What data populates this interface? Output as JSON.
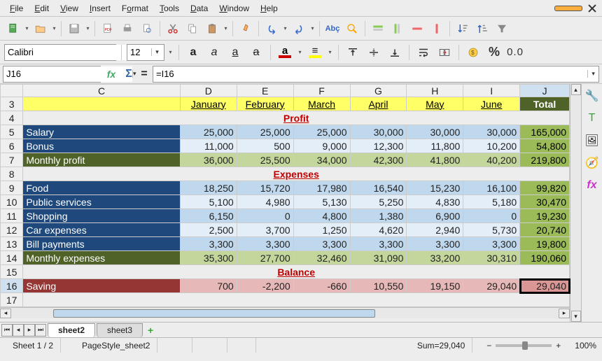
{
  "menu": {
    "file": "File",
    "edit": "Edit",
    "view": "View",
    "insert": "Insert",
    "format": "Format",
    "tools": "Tools",
    "data": "Data",
    "window": "Window",
    "help": "Help"
  },
  "font": {
    "name": "Calibri",
    "size": "12"
  },
  "formula": {
    "cellref": "J16",
    "content": "=I16"
  },
  "columns": [
    "C",
    "D",
    "E",
    "F",
    "G",
    "H",
    "I",
    "J"
  ],
  "rownums": [
    "3",
    "4",
    "5",
    "6",
    "7",
    "8",
    "9",
    "10",
    "11",
    "12",
    "13",
    "14",
    "15",
    "16",
    "17"
  ],
  "months": [
    "January",
    "February",
    "March",
    "April",
    "May",
    "June"
  ],
  "totalLabel": "Total",
  "sections": {
    "profit": "Profit",
    "expenses": "Expenses",
    "balance": "Balance"
  },
  "rows": {
    "salary": {
      "label": "Salary",
      "vals": [
        "25,000",
        "25,000",
        "25,000",
        "30,000",
        "30,000",
        "30,000"
      ],
      "tot": "165,000"
    },
    "bonus": {
      "label": "Bonus",
      "vals": [
        "11,000",
        "500",
        "9,000",
        "12,300",
        "11,800",
        "10,200"
      ],
      "tot": "54,800"
    },
    "mprofit": {
      "label": "Monthly profit",
      "vals": [
        "36,000",
        "25,500",
        "34,000",
        "42,300",
        "41,800",
        "40,200"
      ],
      "tot": "219,800"
    },
    "food": {
      "label": "Food",
      "vals": [
        "18,250",
        "15,720",
        "17,980",
        "16,540",
        "15,230",
        "16,100"
      ],
      "tot": "99,820"
    },
    "public": {
      "label": "Public services",
      "vals": [
        "5,100",
        "4,980",
        "5,130",
        "5,250",
        "4,830",
        "5,180"
      ],
      "tot": "30,470"
    },
    "shopping": {
      "label": "Shopping",
      "vals": [
        "6,150",
        "0",
        "4,800",
        "1,380",
        "6,900",
        "0"
      ],
      "tot": "19,230"
    },
    "car": {
      "label": "Car expenses",
      "vals": [
        "2,500",
        "3,700",
        "1,250",
        "4,620",
        "2,940",
        "5,730"
      ],
      "tot": "20,740"
    },
    "bill": {
      "label": "Bill payments",
      "vals": [
        "3,300",
        "3,300",
        "3,300",
        "3,300",
        "3,300",
        "3,300"
      ],
      "tot": "19,800"
    },
    "mexp": {
      "label": "Monthly expenses",
      "vals": [
        "35,300",
        "27,700",
        "32,460",
        "31,090",
        "33,200",
        "30,310"
      ],
      "tot": "190,060"
    },
    "saving": {
      "label": "Saving",
      "vals": [
        "700",
        "-2,200",
        "-660",
        "10,550",
        "19,150",
        "29,040"
      ],
      "tot": "29,040"
    }
  },
  "tabs": {
    "t1": "sheet2",
    "t2": "sheet3"
  },
  "status": {
    "sheet": "Sheet 1 / 2",
    "pagestyle": "PageStyle_sheet2",
    "sum": "Sum=29,040",
    "zoom": "100%"
  },
  "chart_data": {
    "type": "table",
    "categories": [
      "January",
      "February",
      "March",
      "April",
      "May",
      "June",
      "Total"
    ],
    "series": [
      {
        "name": "Salary",
        "values": [
          25000,
          25000,
          25000,
          30000,
          30000,
          30000,
          165000
        ]
      },
      {
        "name": "Bonus",
        "values": [
          11000,
          500,
          9000,
          12300,
          11800,
          10200,
          54800
        ]
      },
      {
        "name": "Monthly profit",
        "values": [
          36000,
          25500,
          34000,
          42300,
          41800,
          40200,
          219800
        ]
      },
      {
        "name": "Food",
        "values": [
          18250,
          15720,
          17980,
          16540,
          15230,
          16100,
          99820
        ]
      },
      {
        "name": "Public services",
        "values": [
          5100,
          4980,
          5130,
          5250,
          4830,
          5180,
          30470
        ]
      },
      {
        "name": "Shopping",
        "values": [
          6150,
          0,
          4800,
          1380,
          6900,
          0,
          19230
        ]
      },
      {
        "name": "Car expenses",
        "values": [
          2500,
          3700,
          1250,
          4620,
          2940,
          5730,
          20740
        ]
      },
      {
        "name": "Bill payments",
        "values": [
          3300,
          3300,
          3300,
          3300,
          3300,
          3300,
          19800
        ]
      },
      {
        "name": "Monthly expenses",
        "values": [
          35300,
          27700,
          32460,
          31090,
          33200,
          30310,
          190060
        ]
      },
      {
        "name": "Saving",
        "values": [
          700,
          -2200,
          -660,
          10550,
          19150,
          29040,
          29040
        ]
      }
    ]
  }
}
